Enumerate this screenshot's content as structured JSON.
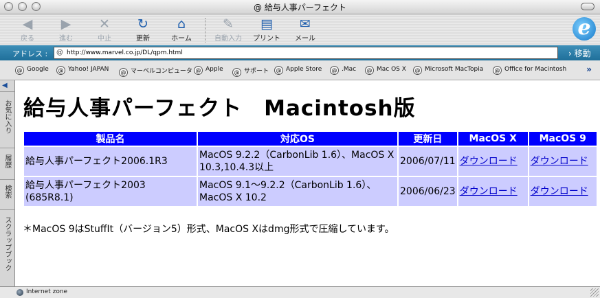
{
  "window": {
    "title": "@ 給与人事パーフェクト"
  },
  "toolbar": {
    "buttons": [
      {
        "label": "戻る",
        "icon": "back-arrow-icon",
        "glyph": "◀"
      },
      {
        "label": "進む",
        "icon": "forward-arrow-icon",
        "glyph": "▶"
      },
      {
        "label": "中止",
        "icon": "stop-icon",
        "glyph": "✕"
      },
      {
        "label": "更新",
        "icon": "refresh-icon",
        "glyph": "↻"
      },
      {
        "label": "ホーム",
        "icon": "home-icon",
        "glyph": "⌂"
      },
      {
        "label": "自動入力",
        "icon": "autofill-icon",
        "glyph": "✎"
      },
      {
        "label": "プリント",
        "icon": "printer-icon",
        "glyph": "▤"
      },
      {
        "label": "メール",
        "icon": "mail-icon",
        "glyph": "✉"
      }
    ],
    "logo_glyph": "e"
  },
  "address": {
    "label": "アドレス :",
    "url": "http://www.marvel.co.jp/DL/qpm.html",
    "go_label": "› 移動"
  },
  "favorites": [
    "Google",
    "Yahoo! JAPAN",
    "マーベルコンピュータ",
    "Apple",
    "サポート",
    "Apple Store",
    ".Mac",
    "Mac OS X",
    "Microsoft MacTopia",
    "Office for Macintosh"
  ],
  "favorites_more": "»",
  "sidebar": {
    "tabs": [
      "お気に入り",
      "履歴",
      "検索",
      "スクラップブック"
    ]
  },
  "page": {
    "title": "給与人事パーフェクト　Macintosh版",
    "table": {
      "headers": [
        "製品名",
        "対応OS",
        "更新日",
        "MacOS X",
        "MacOS 9"
      ],
      "rows": [
        {
          "name": "給与人事パーフェクト2006.1R3",
          "os": "MacOS 9.2.2（CarbonLib 1.6）、MacOS X 10.3,10.4.3以上",
          "date": "2006/07/11",
          "dl_x": "ダウンロード",
          "dl_9": "ダウンロード"
        },
        {
          "name": "給与人事パーフェクト2003 (685R8.1)",
          "os": "MacOS 9.1～9.2.2（CarbonLib 1.6）、MacOS X 10.2",
          "date": "2006/06/23",
          "dl_x": "ダウンロード",
          "dl_9": "ダウンロード"
        }
      ]
    },
    "note": "＊MacOS 9はStuffIt（バージョン5）形式、MacOS Xはdmg形式で圧縮しています。"
  },
  "status": {
    "text": "Internet zone"
  },
  "colors": {
    "header_bg": "#0000ff",
    "cell_bg": "#ccccff",
    "link": "#0000cc",
    "address_bar": "#2a7ca8"
  }
}
